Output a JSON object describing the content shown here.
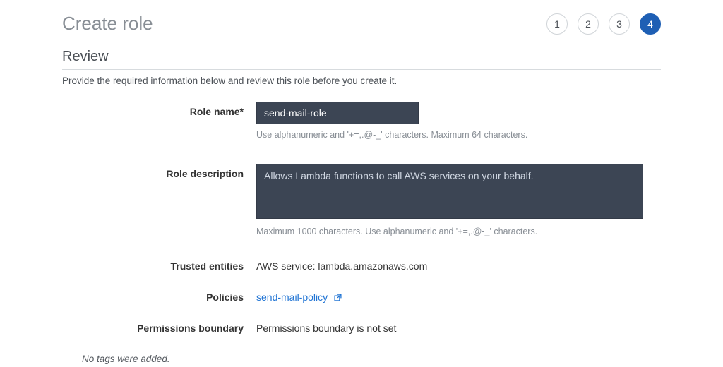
{
  "header": {
    "title": "Create role"
  },
  "stepper": {
    "steps": [
      "1",
      "2",
      "3",
      "4"
    ],
    "active_index": 3
  },
  "section": {
    "title": "Review",
    "subtitle": "Provide the required information below and review this role before you create it."
  },
  "form": {
    "role_name": {
      "label": "Role name*",
      "value": "send-mail-role",
      "hint": "Use alphanumeric and '+=,.@-_' characters. Maximum 64 characters."
    },
    "role_description": {
      "label": "Role description",
      "value": "Allows Lambda functions to call AWS services on your behalf.",
      "hint": "Maximum 1000 characters. Use alphanumeric and '+=,.@-_' characters."
    },
    "trusted_entities": {
      "label": "Trusted entities",
      "value": "AWS service: lambda.amazonaws.com"
    },
    "policies": {
      "label": "Policies",
      "link_text": "send-mail-policy"
    },
    "permissions_boundary": {
      "label": "Permissions boundary",
      "value": "Permissions boundary is not set"
    }
  },
  "tags_note": "No tags were added."
}
